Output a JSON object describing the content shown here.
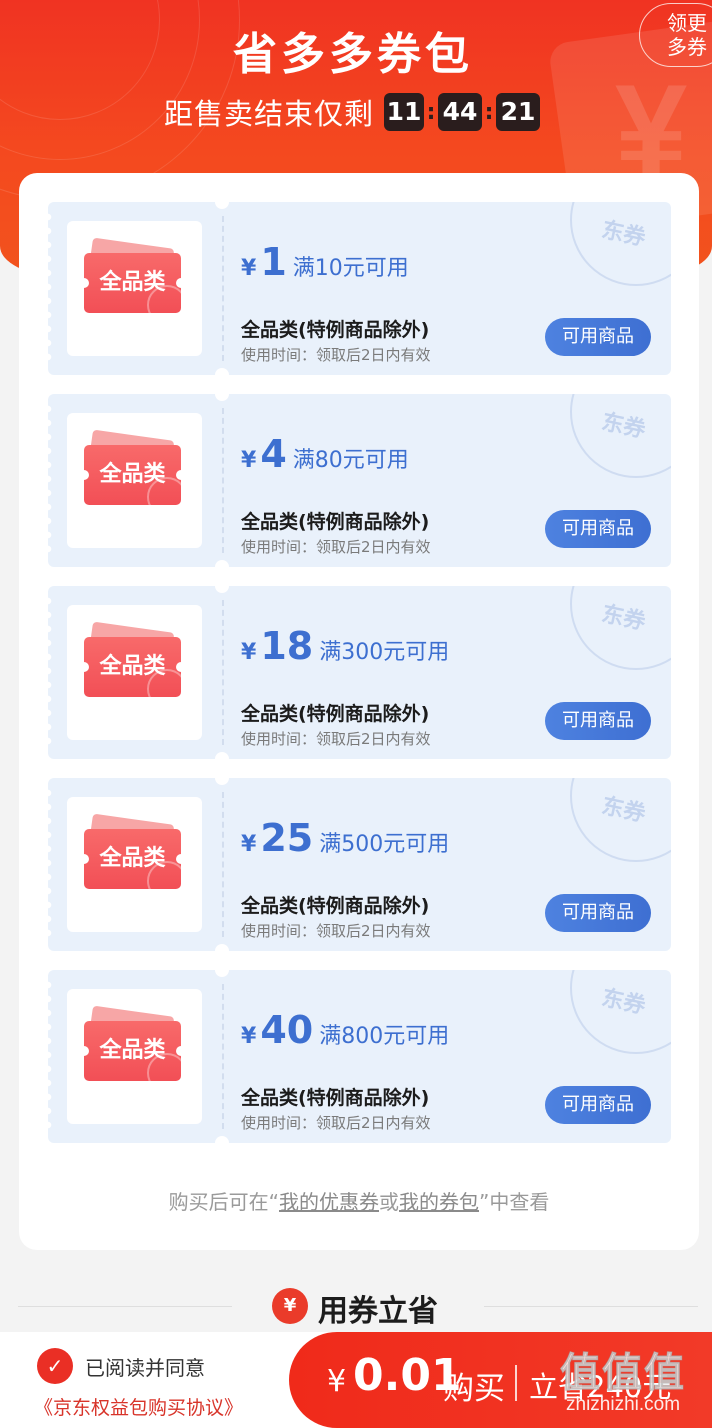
{
  "header": {
    "title": "省多多券包",
    "countdown_label": "距售卖结束仅剩",
    "hours": "11",
    "minutes": "44",
    "seconds": "21",
    "side_button": "领更多券"
  },
  "coupons": [
    {
      "yen": "¥",
      "amount": "1",
      "condition": "满10元可用",
      "title": "全品类(特例商品除外)",
      "time": "使用时间：领取后2日内有效",
      "button": "可用商品",
      "thumb_label": "全品类",
      "seal": "东券"
    },
    {
      "yen": "¥",
      "amount": "4",
      "condition": "满80元可用",
      "title": "全品类(特例商品除外)",
      "time": "使用时间：领取后2日内有效",
      "button": "可用商品",
      "thumb_label": "全品类",
      "seal": "东券"
    },
    {
      "yen": "¥",
      "amount": "18",
      "condition": "满300元可用",
      "title": "全品类(特例商品除外)",
      "time": "使用时间：领取后2日内有效",
      "button": "可用商品",
      "thumb_label": "全品类",
      "seal": "东券"
    },
    {
      "yen": "¥",
      "amount": "25",
      "condition": "满500元可用",
      "title": "全品类(特例商品除外)",
      "time": "使用时间：领取后2日内有效",
      "button": "可用商品",
      "thumb_label": "全品类",
      "seal": "东券"
    },
    {
      "yen": "¥",
      "amount": "40",
      "condition": "满800元可用",
      "title": "全品类(特例商品除外)",
      "time": "使用时间：领取后2日内有效",
      "button": "可用商品",
      "thumb_label": "全品类",
      "seal": "东券"
    }
  ],
  "note": {
    "prefix": "购买后可在“",
    "link1": "我的优惠券",
    "mid": "或",
    "link2": "我的券包",
    "suffix": "”中查看"
  },
  "section": {
    "icon": "ticket-icon",
    "title": "用券立省"
  },
  "bottom": {
    "agree_text": "已阅读并同意",
    "agreement_link": "《京东权益包购买协议》",
    "yen": "¥",
    "price": "0.01",
    "buy_label": "购买",
    "save_label": "立省240元"
  },
  "watermark": {
    "big": "值值值",
    "small": "zhizhizhi.com"
  },
  "colors": {
    "brand_red": "#f03322",
    "coupon_blue": "#3d6fd0",
    "coupon_bg": "#e9f1fb"
  }
}
